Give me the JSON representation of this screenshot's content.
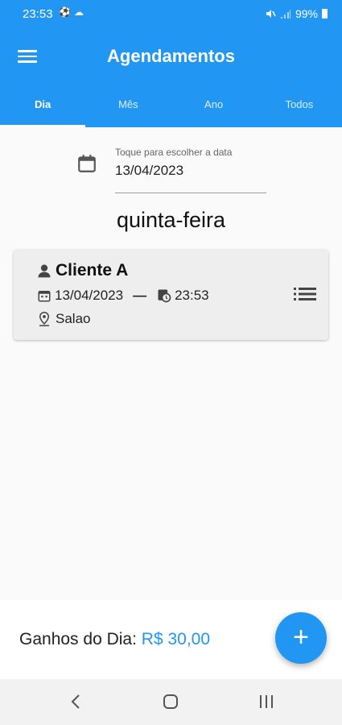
{
  "status_bar": {
    "time": "23:53",
    "battery": "99%"
  },
  "app_bar": {
    "title": "Agendamentos"
  },
  "tabs": [
    {
      "label": "Dia",
      "active": true
    },
    {
      "label": "Mês",
      "active": false
    },
    {
      "label": "Ano",
      "active": false
    },
    {
      "label": "Todos",
      "active": false
    }
  ],
  "date_picker": {
    "label": "Toque para escolher a data",
    "value": "13/04/2023"
  },
  "weekday": "quinta-feira",
  "appointments": [
    {
      "client": "Cliente A",
      "date": "13/04/2023",
      "separator": "—",
      "time": "23:53",
      "location": "Salao"
    }
  ],
  "footer": {
    "earnings_label": "Ganhos do Dia:",
    "earnings_value": "R$ 30,00"
  },
  "fab": {
    "label": "+"
  },
  "colors": {
    "primary": "#2196f3",
    "card_bg": "#eeeeee",
    "page_bg": "#fafafa"
  }
}
